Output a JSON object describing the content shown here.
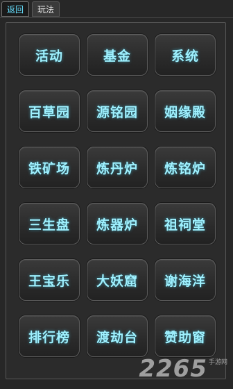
{
  "tabs": [
    {
      "label": "返回",
      "active": true
    },
    {
      "label": "玩法",
      "active": false
    }
  ],
  "menu": {
    "items": [
      {
        "label": "活动"
      },
      {
        "label": "基金"
      },
      {
        "label": "系统"
      },
      {
        "label": "百草园"
      },
      {
        "label": "源铭园"
      },
      {
        "label": "姻缘殿"
      },
      {
        "label": "铁矿场"
      },
      {
        "label": "炼丹炉"
      },
      {
        "label": "炼铭炉"
      },
      {
        "label": "三生盘"
      },
      {
        "label": "炼器炉"
      },
      {
        "label": "祖祠堂"
      },
      {
        "label": "王宝乐"
      },
      {
        "label": "大妖窟"
      },
      {
        "label": "谢海洋"
      },
      {
        "label": "排行榜"
      },
      {
        "label": "渡劫台"
      },
      {
        "label": "赞助窗"
      }
    ]
  },
  "watermark": {
    "number": "2265",
    "suffix": "手游网"
  },
  "colors": {
    "accent": "#9ff1ff",
    "active_tab_text": "#66e0ff",
    "background": "#272727"
  }
}
